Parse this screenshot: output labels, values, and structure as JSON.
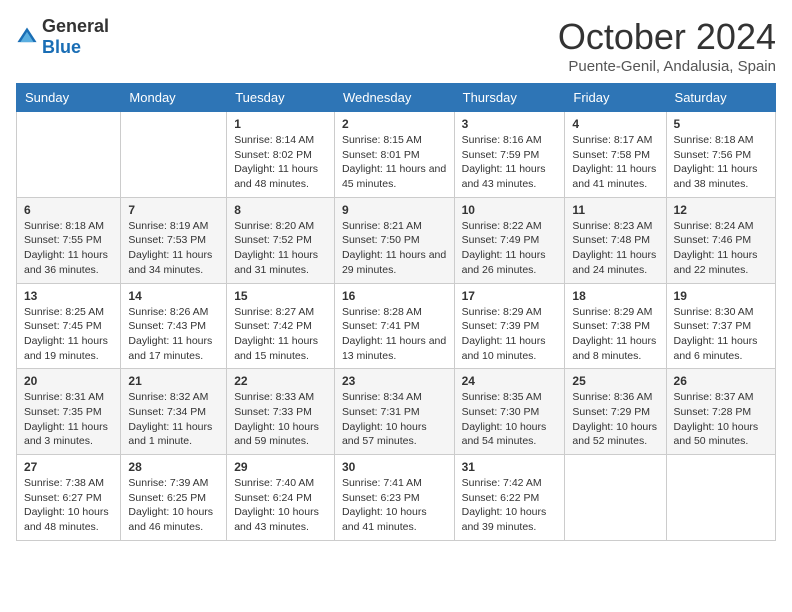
{
  "logo": {
    "general": "General",
    "blue": "Blue"
  },
  "title": "October 2024",
  "location": "Puente-Genil, Andalusia, Spain",
  "days_of_week": [
    "Sunday",
    "Monday",
    "Tuesday",
    "Wednesday",
    "Thursday",
    "Friday",
    "Saturday"
  ],
  "weeks": [
    [
      {
        "day": "",
        "info": ""
      },
      {
        "day": "",
        "info": ""
      },
      {
        "day": "1",
        "info": "Sunrise: 8:14 AM\nSunset: 8:02 PM\nDaylight: 11 hours and 48 minutes."
      },
      {
        "day": "2",
        "info": "Sunrise: 8:15 AM\nSunset: 8:01 PM\nDaylight: 11 hours and 45 minutes."
      },
      {
        "day": "3",
        "info": "Sunrise: 8:16 AM\nSunset: 7:59 PM\nDaylight: 11 hours and 43 minutes."
      },
      {
        "day": "4",
        "info": "Sunrise: 8:17 AM\nSunset: 7:58 PM\nDaylight: 11 hours and 41 minutes."
      },
      {
        "day": "5",
        "info": "Sunrise: 8:18 AM\nSunset: 7:56 PM\nDaylight: 11 hours and 38 minutes."
      }
    ],
    [
      {
        "day": "6",
        "info": "Sunrise: 8:18 AM\nSunset: 7:55 PM\nDaylight: 11 hours and 36 minutes."
      },
      {
        "day": "7",
        "info": "Sunrise: 8:19 AM\nSunset: 7:53 PM\nDaylight: 11 hours and 34 minutes."
      },
      {
        "day": "8",
        "info": "Sunrise: 8:20 AM\nSunset: 7:52 PM\nDaylight: 11 hours and 31 minutes."
      },
      {
        "day": "9",
        "info": "Sunrise: 8:21 AM\nSunset: 7:50 PM\nDaylight: 11 hours and 29 minutes."
      },
      {
        "day": "10",
        "info": "Sunrise: 8:22 AM\nSunset: 7:49 PM\nDaylight: 11 hours and 26 minutes."
      },
      {
        "day": "11",
        "info": "Sunrise: 8:23 AM\nSunset: 7:48 PM\nDaylight: 11 hours and 24 minutes."
      },
      {
        "day": "12",
        "info": "Sunrise: 8:24 AM\nSunset: 7:46 PM\nDaylight: 11 hours and 22 minutes."
      }
    ],
    [
      {
        "day": "13",
        "info": "Sunrise: 8:25 AM\nSunset: 7:45 PM\nDaylight: 11 hours and 19 minutes."
      },
      {
        "day": "14",
        "info": "Sunrise: 8:26 AM\nSunset: 7:43 PM\nDaylight: 11 hours and 17 minutes."
      },
      {
        "day": "15",
        "info": "Sunrise: 8:27 AM\nSunset: 7:42 PM\nDaylight: 11 hours and 15 minutes."
      },
      {
        "day": "16",
        "info": "Sunrise: 8:28 AM\nSunset: 7:41 PM\nDaylight: 11 hours and 13 minutes."
      },
      {
        "day": "17",
        "info": "Sunrise: 8:29 AM\nSunset: 7:39 PM\nDaylight: 11 hours and 10 minutes."
      },
      {
        "day": "18",
        "info": "Sunrise: 8:29 AM\nSunset: 7:38 PM\nDaylight: 11 hours and 8 minutes."
      },
      {
        "day": "19",
        "info": "Sunrise: 8:30 AM\nSunset: 7:37 PM\nDaylight: 11 hours and 6 minutes."
      }
    ],
    [
      {
        "day": "20",
        "info": "Sunrise: 8:31 AM\nSunset: 7:35 PM\nDaylight: 11 hours and 3 minutes."
      },
      {
        "day": "21",
        "info": "Sunrise: 8:32 AM\nSunset: 7:34 PM\nDaylight: 11 hours and 1 minute."
      },
      {
        "day": "22",
        "info": "Sunrise: 8:33 AM\nSunset: 7:33 PM\nDaylight: 10 hours and 59 minutes."
      },
      {
        "day": "23",
        "info": "Sunrise: 8:34 AM\nSunset: 7:31 PM\nDaylight: 10 hours and 57 minutes."
      },
      {
        "day": "24",
        "info": "Sunrise: 8:35 AM\nSunset: 7:30 PM\nDaylight: 10 hours and 54 minutes."
      },
      {
        "day": "25",
        "info": "Sunrise: 8:36 AM\nSunset: 7:29 PM\nDaylight: 10 hours and 52 minutes."
      },
      {
        "day": "26",
        "info": "Sunrise: 8:37 AM\nSunset: 7:28 PM\nDaylight: 10 hours and 50 minutes."
      }
    ],
    [
      {
        "day": "27",
        "info": "Sunrise: 7:38 AM\nSunset: 6:27 PM\nDaylight: 10 hours and 48 minutes."
      },
      {
        "day": "28",
        "info": "Sunrise: 7:39 AM\nSunset: 6:25 PM\nDaylight: 10 hours and 46 minutes."
      },
      {
        "day": "29",
        "info": "Sunrise: 7:40 AM\nSunset: 6:24 PM\nDaylight: 10 hours and 43 minutes."
      },
      {
        "day": "30",
        "info": "Sunrise: 7:41 AM\nSunset: 6:23 PM\nDaylight: 10 hours and 41 minutes."
      },
      {
        "day": "31",
        "info": "Sunrise: 7:42 AM\nSunset: 6:22 PM\nDaylight: 10 hours and 39 minutes."
      },
      {
        "day": "",
        "info": ""
      },
      {
        "day": "",
        "info": ""
      }
    ]
  ]
}
